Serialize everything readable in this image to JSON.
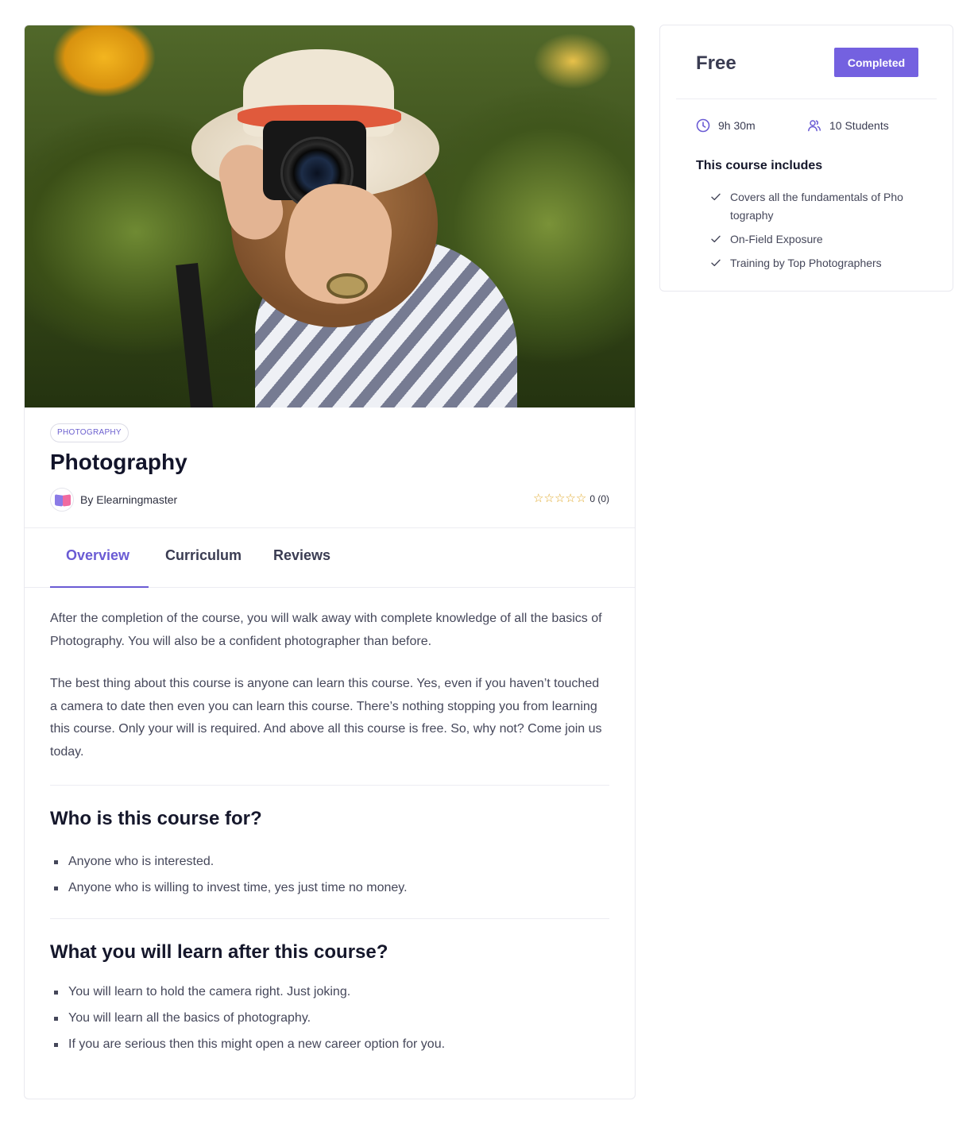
{
  "course": {
    "image_alt": "Woman in a sun hat photographing with a Canon camera in a sunflower field",
    "category": "PHOTOGRAPHY",
    "title": "Photography",
    "author": "By Elearningmaster",
    "rating_value": 0,
    "rating_count_label": "0 (0)",
    "stars": 5
  },
  "tabs": [
    {
      "label": "Overview",
      "active": true
    },
    {
      "label": "Curriculum",
      "active": false
    },
    {
      "label": "Reviews",
      "active": false
    }
  ],
  "overview": {
    "paragraphs": [
      "After the completion of the course, you will walk away with complete knowledge of all the basics of Photography. You will also be a confident photographer than before.",
      "The best thing about this course is anyone can learn this course. Yes, even if you haven’t touched a camera to date then even you can learn this course. There’s nothing stopping you from learning this course. Only your will is required. And above all this course is free. So, why not? Come join us today."
    ],
    "audience": {
      "title": "Who is this course for?",
      "items": [
        "Anyone who is interested.",
        "Anyone who is willing to invest time, yes just time no money."
      ]
    },
    "outcomes": {
      "title": "What you will learn after this course?",
      "items": [
        "You will learn to hold the camera right. Just joking.",
        "You will learn all the basics of photography.",
        "If you are serious then this might open a new career option for you."
      ]
    }
  },
  "sidebar": {
    "price": "Free",
    "status_button": "Completed",
    "duration": "9h 30m",
    "students": "10 Students",
    "includes_title": "This course includes",
    "includes": [
      "Covers all the fundamentals of Pho tography",
      "On-Field Exposure",
      "Training by Top Photographers"
    ]
  },
  "colors": {
    "accent": "#6a5bd4",
    "button": "#7461e0",
    "star": "#e0a92b",
    "text": "#45475a"
  },
  "icons": {
    "duration": "clock-icon",
    "students": "users-icon",
    "include_item": "check-icon",
    "rating": "star-outline-icon",
    "author": "open-book-icon"
  }
}
